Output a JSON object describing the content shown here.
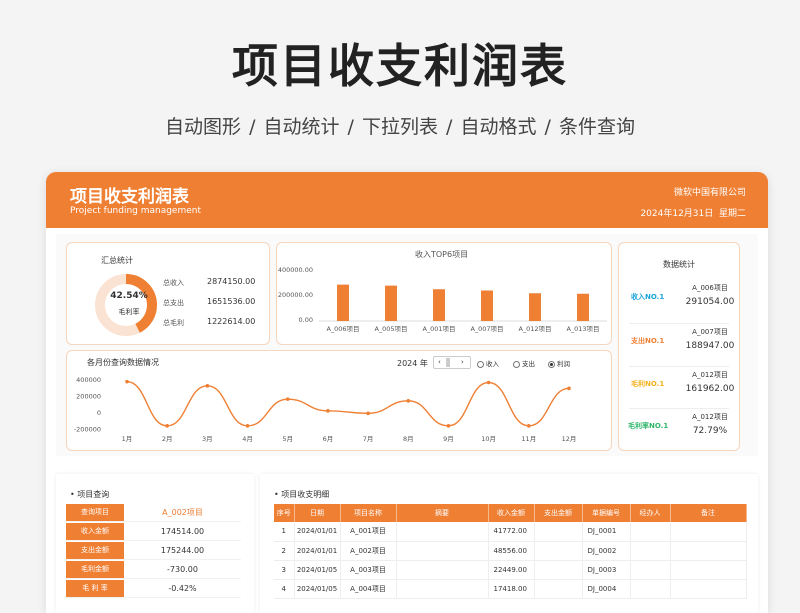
{
  "hero": {
    "title": "项目收支利润表",
    "subtitle": "自动图形  /  自动统计  /  下拉列表  /  自动格式  /  条件查询"
  },
  "banner": {
    "title": "项目收支利润表",
    "subtitle": "Project funding management",
    "company": "微软中国有限公司",
    "date": "2024年12月31日",
    "weekday": "星期二"
  },
  "summary": {
    "title": "汇总统计",
    "margin_pct": "42.54%",
    "margin_value": 0.4254,
    "margin_label": "毛利率",
    "rows": [
      {
        "label": "总收入",
        "value": "2874150.00"
      },
      {
        "label": "总支出",
        "value": "1651536.00"
      },
      {
        "label": "总毛利",
        "value": "1222614.00"
      }
    ]
  },
  "top6": {
    "title": "收入TOP6项目",
    "y_ticks": [
      "400000.00",
      "200000.00",
      "0.00"
    ]
  },
  "monthly": {
    "title": "各月份查询数据情况",
    "year": "2024",
    "year_suffix": "年",
    "radios": [
      {
        "label": "收入",
        "selected": false
      },
      {
        "label": "支出",
        "selected": false
      },
      {
        "label": "利润",
        "selected": true
      }
    ],
    "y_ticks": [
      "400000",
      "200000",
      "0",
      "-200000"
    ]
  },
  "stats": {
    "title": "数据统计",
    "items": [
      {
        "label": "收入NO.1",
        "color": "#1aa3d9",
        "name": "A_006项目",
        "value": "291054.00"
      },
      {
        "label": "支出NO.1",
        "color": "#ef7f33",
        "name": "A_007项目",
        "value": "188947.00"
      },
      {
        "label": "毛利NO.1",
        "color": "#f2b21c",
        "name": "A_012项目",
        "value": "161962.00"
      },
      {
        "label": "毛利率NO.1",
        "color": "#2fb56a",
        "name": "A_012项目",
        "value": "72.79%"
      }
    ]
  },
  "query": {
    "title": "项目查询",
    "rows": [
      {
        "label": "查询项目",
        "value": "A_002项目",
        "accent": "#ef7f33"
      },
      {
        "label": "收入金额",
        "value": "174514.00"
      },
      {
        "label": "支出金额",
        "value": "175244.00"
      },
      {
        "label": "毛利金额",
        "value": "-730.00"
      },
      {
        "label": "毛 利 率",
        "value": "-0.42%"
      }
    ]
  },
  "detail": {
    "title": "项目收支明细",
    "headers": [
      "序号",
      "日期",
      "项目名称",
      "摘要",
      "收入金额",
      "支出金额",
      "单据编号",
      "经办人",
      "备注"
    ],
    "rows": [
      [
        "1",
        "2024/01/01",
        "A_001项目",
        "",
        "41772.00",
        "",
        "DJ_0001",
        "",
        ""
      ],
      [
        "2",
        "2024/01/01",
        "A_002项目",
        "",
        "48556.00",
        "",
        "DJ_0002",
        "",
        ""
      ],
      [
        "3",
        "2024/01/05",
        "A_003项目",
        "",
        "22449.00",
        "",
        "DJ_0003",
        "",
        ""
      ],
      [
        "4",
        "2024/01/05",
        "A_004项目",
        "",
        "17418.00",
        "",
        "DJ_0004",
        "",
        ""
      ]
    ]
  },
  "colors": {
    "accent": "#ef7f33",
    "donut_track": "#fbe3d3"
  },
  "chart_data": [
    {
      "type": "bar",
      "title": "收入TOP6项目",
      "categories": [
        "A_006项目",
        "A_005项目",
        "A_001项目",
        "A_007项目",
        "A_012项目",
        "A_013项目"
      ],
      "values": [
        291054,
        283000,
        254000,
        244000,
        222000,
        218000
      ],
      "ylim": [
        0,
        400000
      ],
      "grid": false,
      "color": "#ef7f33"
    },
    {
      "type": "line",
      "title": "各月份查询数据情况",
      "x": [
        "1月",
        "2月",
        "3月",
        "4月",
        "5月",
        "6月",
        "7月",
        "8月",
        "9月",
        "10月",
        "11月",
        "12月"
      ],
      "series": [
        {
          "name": "利润",
          "values": [
            380000,
            -150000,
            330000,
            -150000,
            170000,
            30000,
            0,
            150000,
            -150000,
            370000,
            -150000,
            300000
          ]
        }
      ],
      "ylim": [
        -200000,
        400000
      ],
      "smooth": true,
      "grid": false,
      "color": "#ef7f33"
    }
  ]
}
